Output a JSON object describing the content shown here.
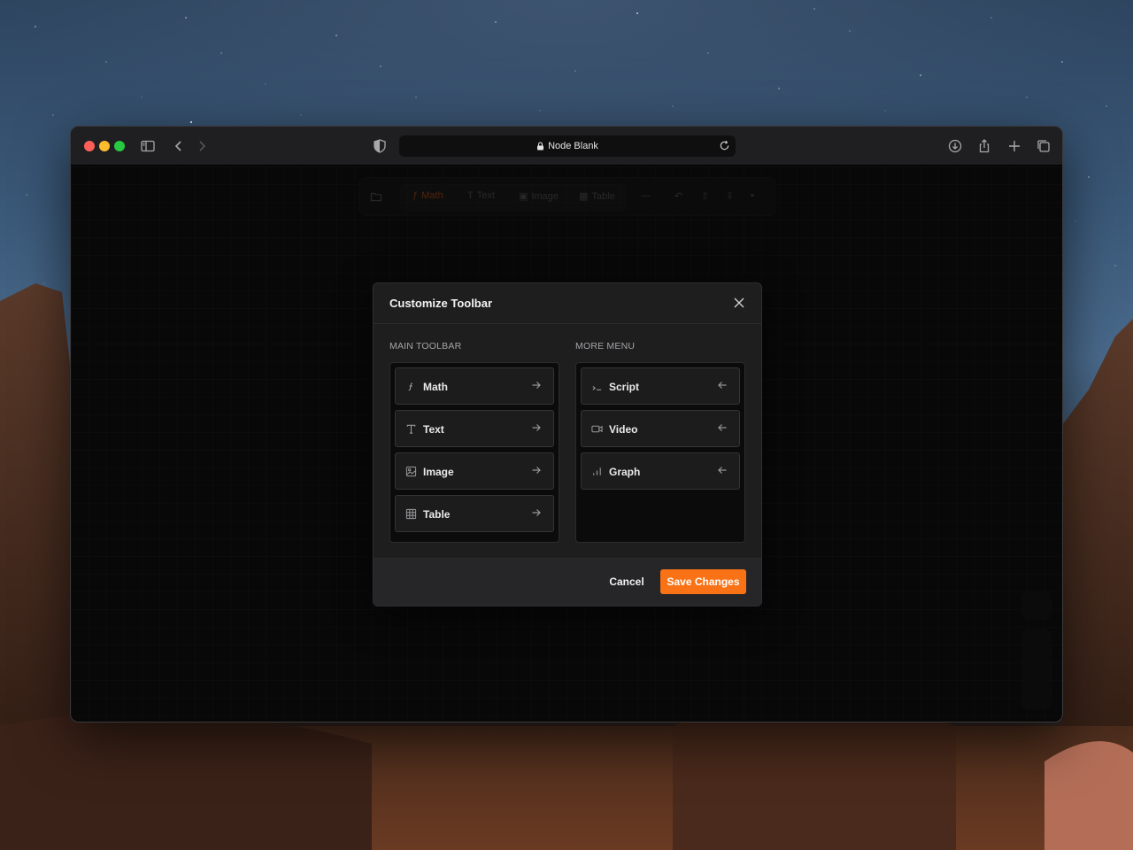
{
  "browser": {
    "url_title": "Node Blank",
    "buttons": [
      "sidebar-toggle",
      "back",
      "forward",
      "privacy-shield",
      "reload",
      "downloads",
      "share",
      "new-tab",
      "tab-overview"
    ]
  },
  "app_toolbar": {
    "items": [
      {
        "label": "Math",
        "icon": "function-icon",
        "active": true
      },
      {
        "label": "Text",
        "icon": "text-icon",
        "active": false
      },
      {
        "label": "Image",
        "icon": "image-icon",
        "active": false
      },
      {
        "label": "Table",
        "icon": "table-icon",
        "active": false
      }
    ]
  },
  "modal": {
    "title": "Customize Toolbar",
    "main_toolbar": {
      "label": "MAIN TOOLBAR",
      "items": [
        {
          "label": "Math",
          "icon": "function-icon"
        },
        {
          "label": "Text",
          "icon": "text-icon"
        },
        {
          "label": "Image",
          "icon": "image-icon"
        },
        {
          "label": "Table",
          "icon": "table-icon"
        }
      ]
    },
    "more_menu": {
      "label": "MORE MENU",
      "items": [
        {
          "label": "Script",
          "icon": "terminal-icon"
        },
        {
          "label": "Video",
          "icon": "video-icon"
        },
        {
          "label": "Graph",
          "icon": "bar-chart-icon"
        }
      ]
    },
    "cancel_label": "Cancel",
    "save_label": "Save Changes"
  },
  "colors": {
    "accent": "#f97316",
    "modal_bg": "#1e1e1f",
    "canvas_bg": "#0b0b0c"
  }
}
